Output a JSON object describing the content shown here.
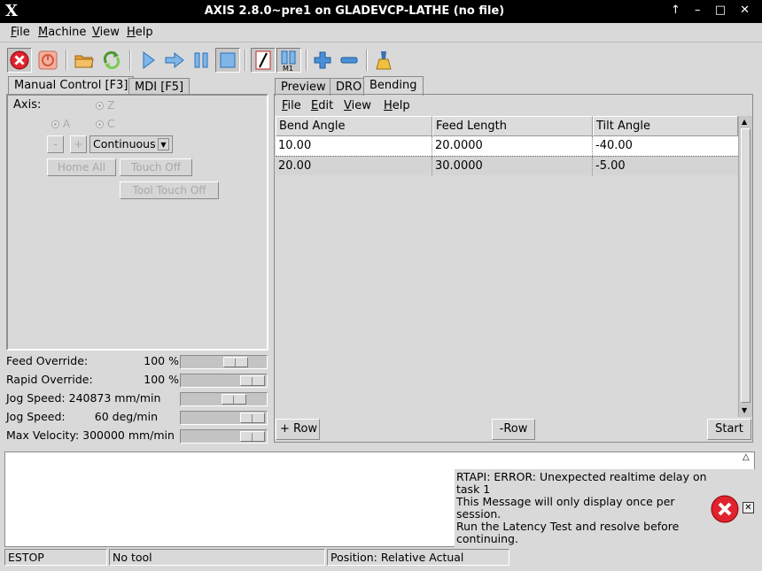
{
  "window": {
    "title": "AXIS 2.8.0~pre1 on GLADEVCP-LATHE (no file)",
    "controls": "↑ – □ ✕"
  },
  "menubar": [
    "File",
    "Machine",
    "View",
    "Help"
  ],
  "toolbar": {
    "icons": [
      "estop-icon",
      "power-icon",
      "open-file-icon",
      "reload-icon",
      "run-icon",
      "step-icon",
      "pause-icon",
      "stop-icon",
      "block-delete-icon",
      "optional-stop-icon",
      "zoom-in-icon",
      "zoom-out-icon",
      "clear-plot-icon"
    ]
  },
  "left_tabs": [
    "Manual Control [F3]",
    "MDI [F5]"
  ],
  "manual": {
    "axis_label": "Axis:",
    "axes": [
      "Z",
      "A",
      "C"
    ],
    "jog_minus": "-",
    "jog_plus": "+",
    "jog_mode": "Continuous",
    "home_all": "Home All",
    "touch_off": "Touch Off",
    "tool_touch_off": "Tool Touch Off"
  },
  "overrides": [
    {
      "label": "Feed Override:",
      "value": "100 %",
      "level": 0.72
    },
    {
      "label": "Rapid Override:",
      "value": "100 %",
      "level": 1.0
    },
    {
      "label": "Jog Speed: 240873 mm/min",
      "value": "",
      "level": 0.68
    },
    {
      "label": "Jog Speed:",
      "value": "60 deg/min",
      "level": 1.0
    },
    {
      "label": "Max Velocity: 300000 mm/min",
      "value": "",
      "level": 1.0
    }
  ],
  "right_tabs": [
    "Preview",
    "DRO",
    "Bending"
  ],
  "bending": {
    "menu": [
      "File",
      "Edit",
      "View",
      "Help"
    ],
    "columns": [
      "Bend Angle",
      "Feed Length",
      "Tilt Angle"
    ],
    "rows": [
      [
        "10.00",
        "20.0000",
        "-40.00"
      ],
      [
        "20.00",
        "30.0000",
        "-5.00"
      ]
    ],
    "add_row": "+ Row",
    "remove_row": "-Row",
    "start": "Start"
  },
  "error": {
    "lines": [
      "RTAPI: ERROR: Unexpected realtime delay on",
      "task 1",
      "This Message will only display once per session.",
      "Run the Latency Test and resolve before",
      "continuing."
    ]
  },
  "status": {
    "state": "ESTOP",
    "tool": "No tool",
    "position": "Position: Relative Actual"
  },
  "colors": {
    "titlebar": "#000000",
    "background": "#d9d9d9",
    "error_red": "#e0232e",
    "run_blue": "#3b8fd8"
  }
}
